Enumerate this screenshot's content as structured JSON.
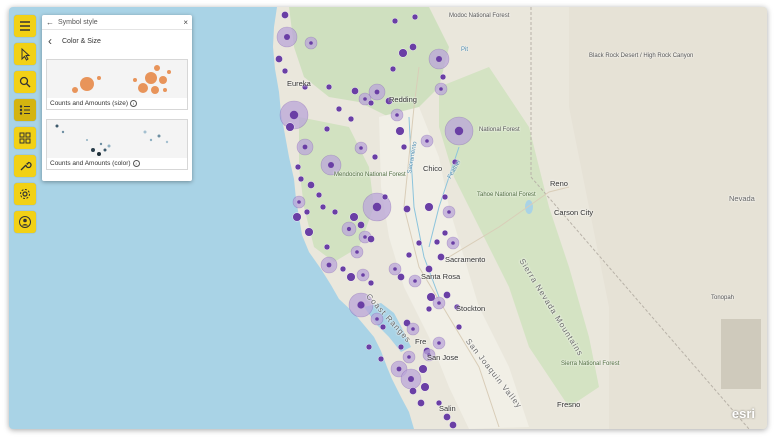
{
  "toolbar": {
    "buttons": [
      {
        "name": "menu-icon",
        "active": false
      },
      {
        "name": "select-pointer-icon",
        "active": false
      },
      {
        "name": "search-icon",
        "active": false
      },
      {
        "name": "legend-list-icon",
        "active": true
      },
      {
        "name": "basemap-gallery-icon",
        "active": false
      },
      {
        "name": "tools-wrench-icon",
        "active": false
      },
      {
        "name": "settings-gear-icon",
        "active": false
      },
      {
        "name": "user-account-icon",
        "active": false
      }
    ],
    "accent": "#f2d116"
  },
  "panel": {
    "title": "Symbol style",
    "subtitle": "Color & Size",
    "options": [
      {
        "label": "Counts and Amounts (size)"
      },
      {
        "label": "Counts and Amounts (color)"
      }
    ]
  },
  "map": {
    "labels": {
      "modoc": "Modoc National Forest",
      "black_rock": "Black Rock Desert / High Rock Canyon",
      "eureka": "Eureka",
      "redding": "Redding",
      "national_forest": "National Forest",
      "chico": "Chico",
      "reno": "Reno",
      "mendocino": "Mendocino National Forest",
      "tahoe": "Tahoe National Forest",
      "carson_city": "Carson City",
      "nevada": "Nevada",
      "sacramento": "Sacramento",
      "stockton": "Stockton",
      "santa_rosa_fragment": "Santa Rosa",
      "coast_ranges": "Coast Ranges",
      "sierra_nevada": "Sierra Nevada Mountains",
      "tonopah": "Tonopah",
      "sierra_forest": "Sierra National Forest",
      "fremont_fragment": "Fre",
      "san_jose_fragment": "San Jose",
      "san_joaquin": "San Joaquin Valley",
      "fresno": "Fresno",
      "salinas_fragment": "Salin",
      "pit": "Pit",
      "sacramento_river": "Sacramento",
      "feather": "Feather"
    },
    "attribution": "esri",
    "symbol_color": "#6a3fa5",
    "halo_color": "#b9a6d8"
  }
}
